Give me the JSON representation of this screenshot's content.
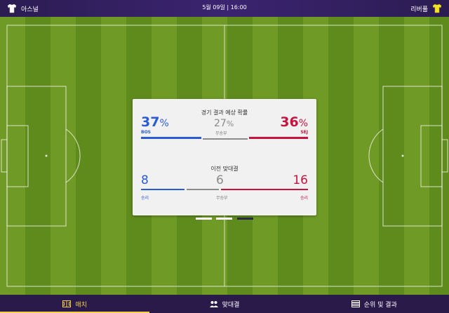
{
  "header": {
    "home_team": "아스널",
    "away_team": "리버풀",
    "datetime": "5월 09일 | 16:00"
  },
  "prediction": {
    "title": "경기 결과 예상 확률",
    "home_pct": "37",
    "draw_pct": "27",
    "away_pct": "36",
    "pct_sign": "%",
    "home_abbr": "BOS",
    "draw_label": "무승부",
    "away_abbr": "SEJ"
  },
  "head_to_head": {
    "title": "이전 맞대결",
    "home_wins": "8",
    "draws": "6",
    "away_wins": "16",
    "home_label": "승리",
    "draw_label": "무승부",
    "away_label": "승리"
  },
  "nav": {
    "tabs": [
      {
        "label": "매치",
        "icon": "match-icon"
      },
      {
        "label": "맞대결",
        "icon": "head-to-head-icon"
      },
      {
        "label": "순위 및 결과",
        "icon": "standings-icon"
      }
    ]
  },
  "colors": {
    "home": "#2a5bd7",
    "draw": "#8a8a8a",
    "away": "#c8133f",
    "accent": "#f1d14a"
  }
}
